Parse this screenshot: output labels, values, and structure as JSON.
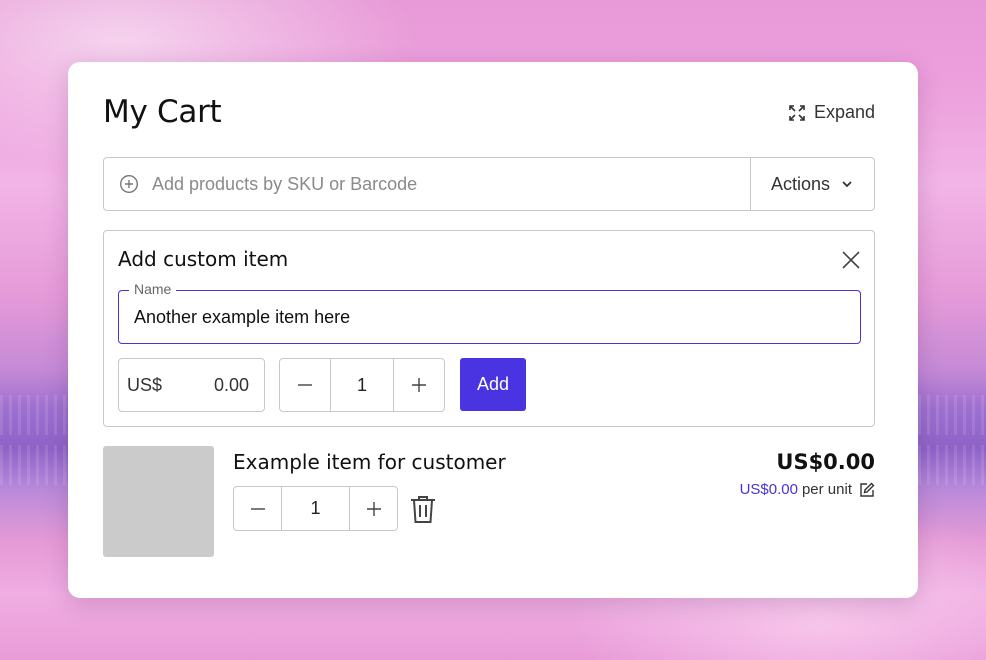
{
  "cart": {
    "title": "My Cart",
    "expand_label": "Expand"
  },
  "search": {
    "placeholder": "Add products by SKU or Barcode",
    "value": "",
    "actions_label": "Actions"
  },
  "custom_item": {
    "title": "Add custom item",
    "name_label": "Name",
    "name_value": "Another example item here",
    "currency": "US$",
    "price": "0.00",
    "quantity": "1",
    "add_label": "Add"
  },
  "line_items": [
    {
      "name": "Example item for customer",
      "quantity": "1",
      "total": "US$0.00",
      "unit_price": "US$0.00",
      "unit_suffix": "per unit"
    }
  ],
  "colors": {
    "accent": "#4a33e0",
    "focus_border": "#4a33d6",
    "thumbnail": "#cbcbcb"
  },
  "icons": [
    "expand-icon",
    "add-circle-icon",
    "chevron-down-icon",
    "close-icon",
    "minus-icon",
    "plus-icon",
    "trash-icon",
    "edit-icon"
  ]
}
